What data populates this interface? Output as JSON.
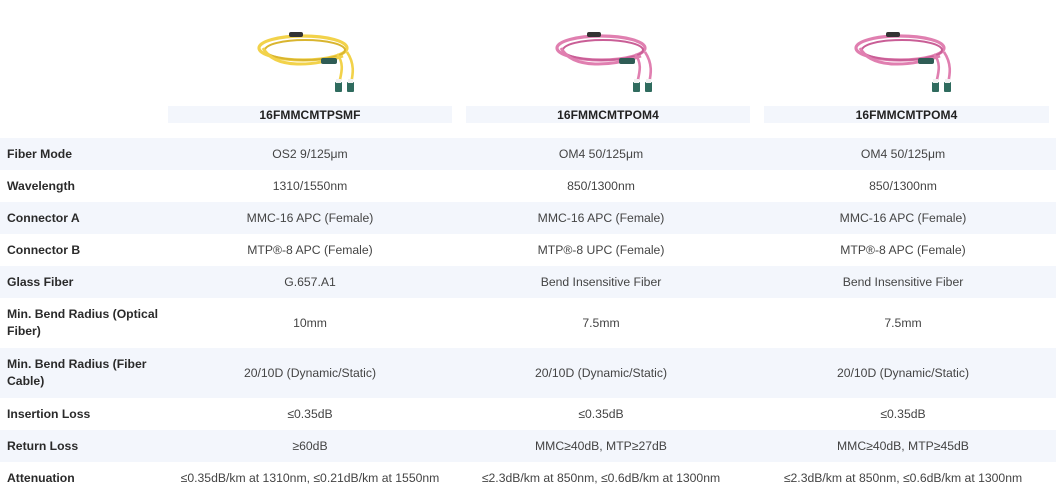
{
  "products": [
    {
      "name": "16FMMCMTPSMF",
      "cable_color": "#f2d24a",
      "cable_dark": "#d9b52f",
      "image": "yellow-fiber-cable-image"
    },
    {
      "name": "16FMMCMTPOM4",
      "cable_color": "#e07fb0",
      "cable_dark": "#c95e96",
      "image": "pink-fiber-cable-image"
    },
    {
      "name": "16FMMCMTPOM4",
      "cable_color": "#e07fb0",
      "cable_dark": "#c95e96",
      "image": "pink-fiber-cable-image"
    }
  ],
  "rows": [
    {
      "label": "Fiber Mode",
      "values": [
        "OS2 9/125μm",
        "OM4 50/125μm",
        "OM4 50/125μm"
      ]
    },
    {
      "label": "Wavelength",
      "values": [
        "1310/1550nm",
        "850/1300nm",
        "850/1300nm"
      ]
    },
    {
      "label": "Connector A",
      "values": [
        "MMC-16 APC (Female)",
        "MMC-16 APC (Female)",
        "MMC-16 APC (Female)"
      ]
    },
    {
      "label": "Connector B",
      "values": [
        "MTP®-8 APC (Female)",
        "MTP®-8 UPC (Female)",
        "MTP®-8 APC (Female)"
      ]
    },
    {
      "label": "Glass Fiber",
      "values": [
        "G.657.A1",
        "Bend Insensitive Fiber",
        "Bend Insensitive Fiber"
      ]
    },
    {
      "label": "Min. Bend Radius (Optical Fiber)",
      "values": [
        "10mm",
        "7.5mm",
        "7.5mm"
      ]
    },
    {
      "label": "Min. Bend Radius (Fiber Cable)",
      "values": [
        "20/10D (Dynamic/Static)",
        "20/10D (Dynamic/Static)",
        "20/10D (Dynamic/Static)"
      ]
    },
    {
      "label": "Insertion Loss",
      "values": [
        "≤0.35dB",
        "≤0.35dB",
        "≤0.35dB"
      ]
    },
    {
      "label": "Return Loss",
      "values": [
        "≥60dB",
        "MMC≥40dB, MTP≥27dB",
        "MMC≥40dB, MTP≥45dB"
      ]
    },
    {
      "label": "Attenuation",
      "values": [
        "≤0.35dB/km at 1310nm, ≤0.21dB/km at 1550nm",
        "≤2.3dB/km at 850nm, ≤0.6dB/km at 1300nm",
        "≤2.3dB/km at 850nm, ≤0.6dB/km at 1300nm"
      ]
    }
  ]
}
